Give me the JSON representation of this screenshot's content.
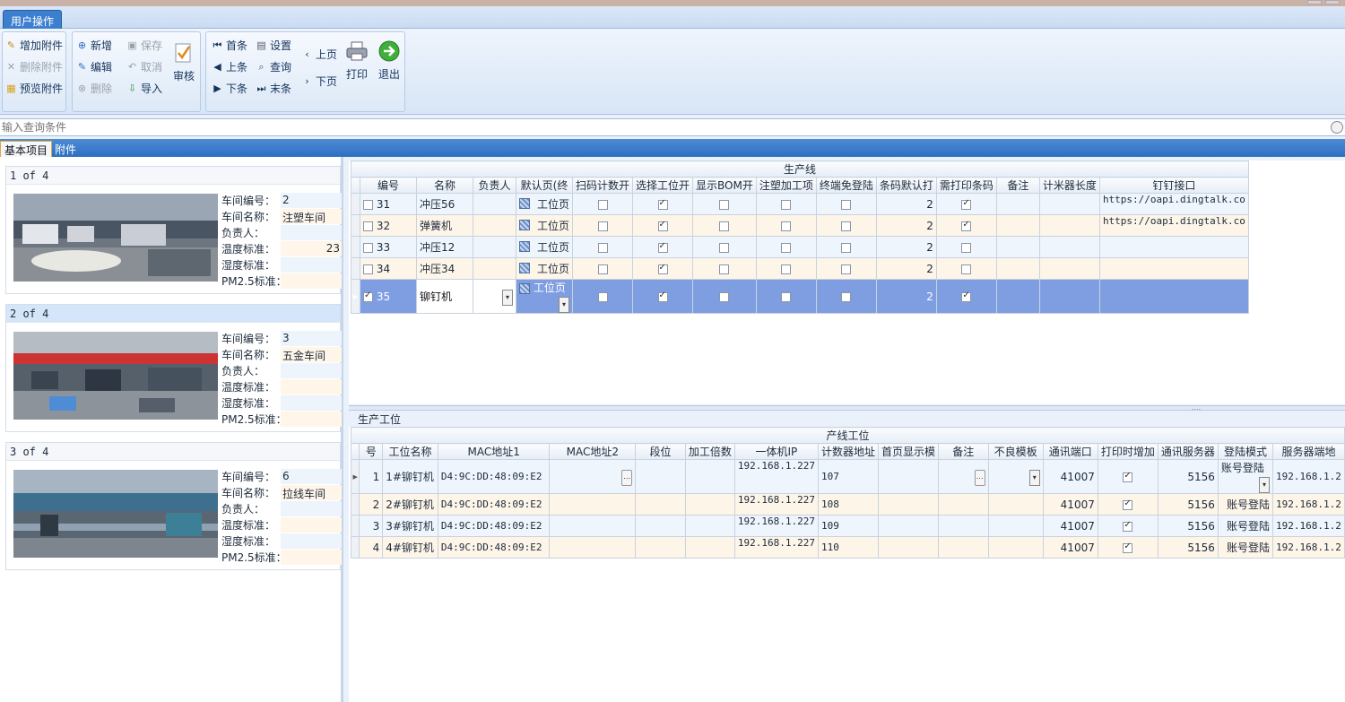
{
  "ribbon": {
    "tab": "用户操作",
    "attach": {
      "add": "增加附件",
      "delete": "删除附件",
      "preview": "预览附件"
    },
    "edit": {
      "new": "新增",
      "edit": "编辑",
      "delete": "删除",
      "save": "保存",
      "cancel": "取消",
      "import": "导入",
      "audit": "审核"
    },
    "nav": {
      "first": "首条",
      "prev": "上条",
      "next": "下条",
      "settings": "设置",
      "query": "查询",
      "last": "末条",
      "page_up": "上页",
      "page_down": "下页",
      "print": "打印",
      "exit": "退出"
    }
  },
  "search": {
    "placeholder": "输入查询条件"
  },
  "doc_tabs": [
    "基本项目",
    "附件"
  ],
  "workshops": [
    {
      "pager": "1 of 4",
      "labels": [
        "车间编号：",
        "车间名称：",
        "负责人：",
        "温度标准：",
        "湿度标准：",
        "PM2.5标准："
      ],
      "values": [
        "2",
        "注塑车间",
        "",
        "23",
        "",
        ""
      ]
    },
    {
      "pager": "2 of 4",
      "labels": [
        "车间编号：",
        "车间名称：",
        "负责人：",
        "温度标准：",
        "湿度标准：",
        "PM2.5标准："
      ],
      "values": [
        "3",
        "五金车间",
        "",
        "",
        "",
        ""
      ]
    },
    {
      "pager": "3 of 4",
      "labels": [
        "车间编号：",
        "车间名称：",
        "负责人：",
        "温度标准：",
        "湿度标准：",
        "PM2.5标准："
      ],
      "values": [
        "6",
        "拉线车间",
        "",
        "",
        "",
        ""
      ]
    }
  ],
  "production_line": {
    "band": "生产线",
    "headers": [
      "编号",
      "名称",
      "负责人",
      "默认页(终",
      "扫码计数开",
      "选择工位开",
      "显示BOM开",
      "注塑加工项",
      "终端免登陆",
      "条码默认打",
      "需打印条码",
      "备注",
      "计米器长度",
      "钉钉接口"
    ],
    "rows": [
      {
        "id": "31",
        "name": "冲压56",
        "page": "工位页",
        "barcode_default": "2",
        "dingtalk": "https://oapi.dingtalk.co"
      },
      {
        "id": "32",
        "name": "弹簧机",
        "page": "工位页",
        "barcode_default": "2",
        "dingtalk": "https://oapi.dingtalk.co"
      },
      {
        "id": "33",
        "name": "冲压12",
        "page": "工位页",
        "barcode_default": "2",
        "dingtalk": ""
      },
      {
        "id": "34",
        "name": "冲压34",
        "page": "工位页",
        "barcode_default": "2",
        "dingtalk": ""
      },
      {
        "id": "35",
        "name": "铆钉机",
        "page": "工位页",
        "barcode_default": "2",
        "dingtalk": ""
      }
    ]
  },
  "stations": {
    "section_label": "生产工位",
    "band": "产线工位",
    "headers": [
      "号",
      "工位名称",
      "MAC地址1",
      "MAC地址2",
      "段位",
      "加工倍数",
      "一体机IP",
      "计数器地址",
      "首页显示模",
      "备注",
      "不良模板",
      "通讯端口",
      "打印时增加",
      "通讯服务器",
      "登陆模式",
      "服务器端地"
    ],
    "rows": [
      {
        "no": "1",
        "name": "1#铆钉机",
        "mac1": "D4:9C:DD:48:09:E2",
        "ip": "192.168.1.227",
        "counter": "107",
        "port": "41007",
        "server_port": "5156",
        "login": "账号登陆",
        "server": "192.168.1.2"
      },
      {
        "no": "2",
        "name": "2#铆钉机",
        "mac1": "D4:9C:DD:48:09:E2",
        "ip": "192.168.1.227",
        "counter": "108",
        "port": "41007",
        "server_port": "5156",
        "login": "账号登陆",
        "server": "192.168.1.2"
      },
      {
        "no": "3",
        "name": "3#铆钉机",
        "mac1": "D4:9C:DD:48:09:E2",
        "ip": "192.168.1.227",
        "counter": "109",
        "port": "41007",
        "server_port": "5156",
        "login": "账号登陆",
        "server": "192.168.1.2"
      },
      {
        "no": "4",
        "name": "4#铆钉机",
        "mac1": "D4:9C:DD:48:09:E2",
        "ip": "192.168.1.227",
        "counter": "110",
        "port": "41007",
        "server_port": "5156",
        "login": "账号登陆",
        "server": "192.168.1.2"
      }
    ]
  }
}
